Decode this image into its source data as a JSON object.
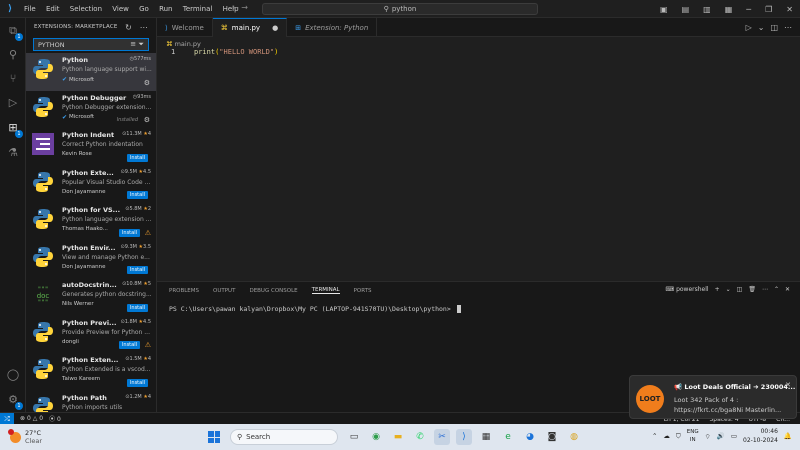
{
  "titlebar": {
    "menu": [
      "File",
      "Edit",
      "Selection",
      "View",
      "Go",
      "Run",
      "Terminal",
      "Help"
    ],
    "command_center": "python"
  },
  "sidebar": {
    "title": "EXTENSIONS: MARKETPLACE",
    "search_value": "PYTHON",
    "extensions": [
      {
        "name": "Python",
        "stat": "577ms",
        "rating": "",
        "desc": "Python language support wi...",
        "publisher": "Microsoft",
        "verified": true,
        "action": "gear",
        "installed_label": "",
        "icon": "python-logo"
      },
      {
        "name": "Python Debugger",
        "stat": "93ms",
        "rating": "",
        "desc": "Python Debugger extension...",
        "publisher": "Microsoft",
        "verified": true,
        "action": "gear",
        "installed_label": "Installed",
        "icon": "python-logo"
      },
      {
        "name": "Python Indent",
        "stat": "11.3M",
        "rating": "4",
        "desc": "Correct Python indentation",
        "publisher": "Kevin Rose",
        "verified": false,
        "action": "Install",
        "installed_label": "",
        "icon": "indent-logo"
      },
      {
        "name": "Python Exte...",
        "stat": "9.5M",
        "rating": "4.5",
        "desc": "Popular Visual Studio Code ...",
        "publisher": "Don Jayamanne",
        "verified": false,
        "action": "Install",
        "installed_label": "",
        "icon": "python-logo"
      },
      {
        "name": "Python for VS...",
        "stat": "5.8M",
        "rating": "2",
        "desc": "Python language extension ...",
        "publisher": "Thomas Haako...",
        "verified": false,
        "action": "Install",
        "installed_label": "",
        "icon": "python-logo"
      },
      {
        "name": "Python Envir...",
        "stat": "9.3M",
        "rating": "3.5",
        "desc": "View and manage Python e...",
        "publisher": "Don Jayamanne",
        "verified": false,
        "action": "Install",
        "installed_label": "",
        "icon": "python-logo"
      },
      {
        "name": "autoDocstrin...",
        "stat": "10.8M",
        "rating": "5",
        "desc": "Generates python docstring...",
        "publisher": "Nils Werner",
        "verified": false,
        "action": "Install",
        "installed_label": "",
        "icon": "doc-logo"
      },
      {
        "name": "Python Previ...",
        "stat": "1.8M",
        "rating": "4.5",
        "desc": "Provide Preview for Python ...",
        "publisher": "dongli",
        "verified": false,
        "action": "Install",
        "installed_label": "",
        "icon": "python-logo"
      },
      {
        "name": "Python Exten...",
        "stat": "1.5M",
        "rating": "4",
        "desc": "Python Extended is a vscod...",
        "publisher": "Taiwo Kareem",
        "verified": false,
        "action": "Install",
        "installed_label": "",
        "icon": "python-logo"
      },
      {
        "name": "Python Path",
        "stat": "1.2M",
        "rating": "4",
        "desc": "Python imports utils",
        "publisher": "",
        "verified": false,
        "action": "",
        "installed_label": "",
        "icon": "python-logo"
      }
    ]
  },
  "editor": {
    "tabs": [
      {
        "label": "Welcome",
        "active": false
      },
      {
        "label": "main.py",
        "active": true
      },
      {
        "label": "Extension: Python",
        "active": false
      }
    ],
    "breadcrumb": "main.py",
    "line_number": "1",
    "code": {
      "fn": "print",
      "open": "(",
      "str": "\"HELLO WORLD\"",
      "close": ")"
    }
  },
  "panel": {
    "tabs": [
      "PROBLEMS",
      "OUTPUT",
      "DEBUG CONSOLE",
      "TERMINAL",
      "PORTS"
    ],
    "active_tab": "TERMINAL",
    "shell": "powershell",
    "prompt": "PS C:\\Users\\pawan kalyan\\Dropbox\\My PC (LAPTOP-941S70TU)\\Desktop\\python> "
  },
  "statusbar": {
    "errors": "0",
    "warnings": "0",
    "ports": "0",
    "position": "Ln 1, Col 21",
    "spaces": "Spaces: 4",
    "encoding": "UTF-8",
    "eol": "CR..."
  },
  "notification": {
    "title": "Loot Deals Official ➔ 230004...",
    "line2": "Loot 342  Pack of 4 :",
    "line3": "https://fkrt.cc/bga8Ni  Masterlin...",
    "icon_text": "LOOT"
  },
  "taskbar": {
    "temperature": "27°C",
    "weather_desc": "Clear",
    "search_label": "Search",
    "lang_top": "ENG",
    "lang_bottom": "IN",
    "time": "00:46",
    "date": "02-10-2024"
  },
  "colors": {
    "accent": "#0078d4",
    "install": "#0078d4",
    "star": "#f0a030",
    "python_blue": "#3776ab",
    "python_yellow": "#ffd43b"
  }
}
